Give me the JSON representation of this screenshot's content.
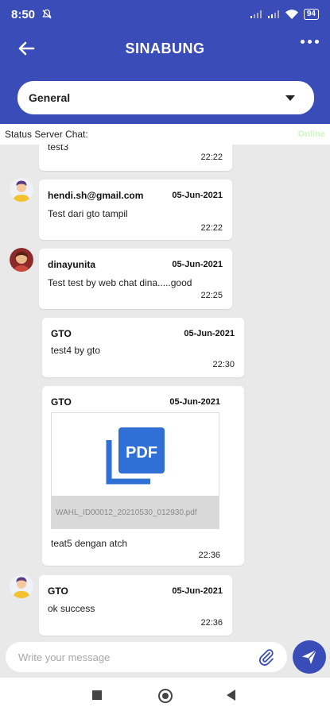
{
  "status_bar": {
    "time": "8:50",
    "battery": "94"
  },
  "app_bar": {
    "title": "SINABUNG"
  },
  "channel_select": {
    "selected": "General"
  },
  "server_status": {
    "label": "Status Server Chat:",
    "value": "Online"
  },
  "messages": [
    {
      "sender": "",
      "date": "",
      "text": "test3",
      "time": "22:22"
    },
    {
      "sender": "hendi.sh@gmail.com",
      "date": "05-Jun-2021",
      "text": "Test dari gto tampil",
      "time": "22:22"
    },
    {
      "sender": "dinayunita",
      "date": "05-Jun-2021",
      "text": "Test test by web chat dina.....good",
      "time": "22:25"
    },
    {
      "sender": "GTO",
      "date": "05-Jun-2021",
      "text": "test4 by gto",
      "time": "22:30"
    },
    {
      "sender": "GTO",
      "date": "05-Jun-2021",
      "attachment_label": "PDF",
      "attachment_name": "WAHL_ID00012_20210530_012930.pdf",
      "text": "teat5 dengan atch",
      "time": "22:36"
    },
    {
      "sender": "GTO",
      "date": "05-Jun-2021",
      "text": "ok success",
      "time": "22:36"
    }
  ],
  "composer": {
    "placeholder": "Write your message"
  },
  "colors": {
    "primary": "#3a4cb8",
    "background": "#e9e9e9",
    "pdf_blue": "#2f6fd6",
    "online": "#d2f3c2"
  },
  "icons": [
    "back-arrow-icon",
    "more-icon",
    "chevron-down-icon",
    "avatar-icon",
    "pdf-icon",
    "paperclip-icon",
    "send-icon",
    "nav-recents-icon",
    "nav-home-icon",
    "nav-back-icon"
  ]
}
